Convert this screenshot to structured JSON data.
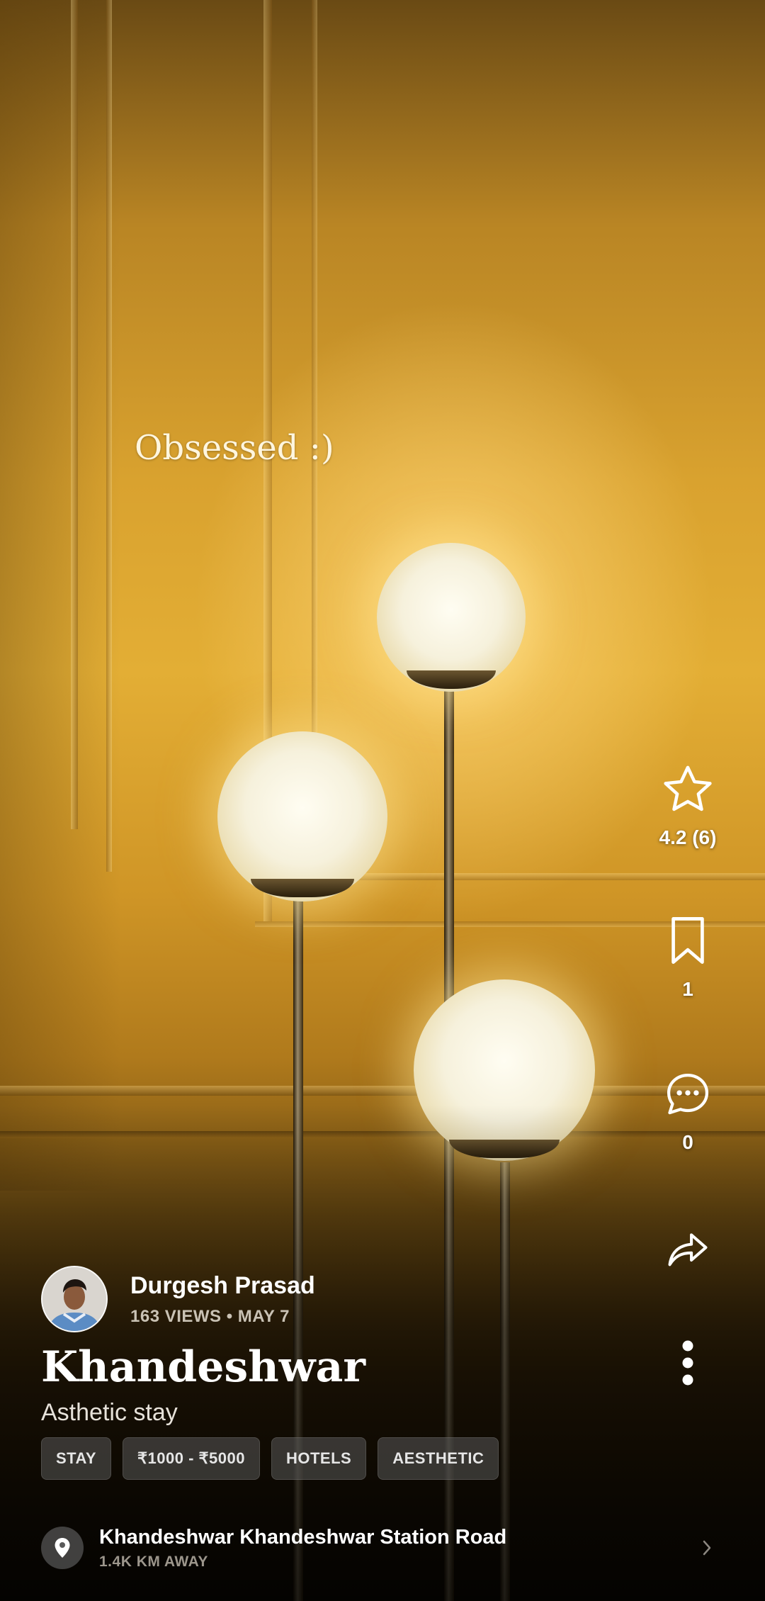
{
  "story": {
    "caption": "Obsessed :)"
  },
  "actions": {
    "rating": {
      "icon": "star-icon",
      "label": "4.2 (6)"
    },
    "save": {
      "icon": "bookmark-icon",
      "count": "1"
    },
    "comments": {
      "icon": "comment-icon",
      "count": "0"
    },
    "share": {
      "icon": "share-icon"
    },
    "more": {
      "icon": "more-vertical-icon"
    }
  },
  "author": {
    "name": "Durgesh Prasad",
    "meta": "163 VIEWS • MAY 7"
  },
  "place": {
    "title": "Khandeshwar",
    "subtitle": "Asthetic stay"
  },
  "tags": [
    "STAY",
    "₹1000 - ₹5000",
    "HOTELS",
    "AESTHETIC"
  ],
  "location": {
    "icon": "location-pin-icon",
    "name": "Khandeshwar Khandeshwar Station Road",
    "distance": "1.4K KM AWAY"
  }
}
